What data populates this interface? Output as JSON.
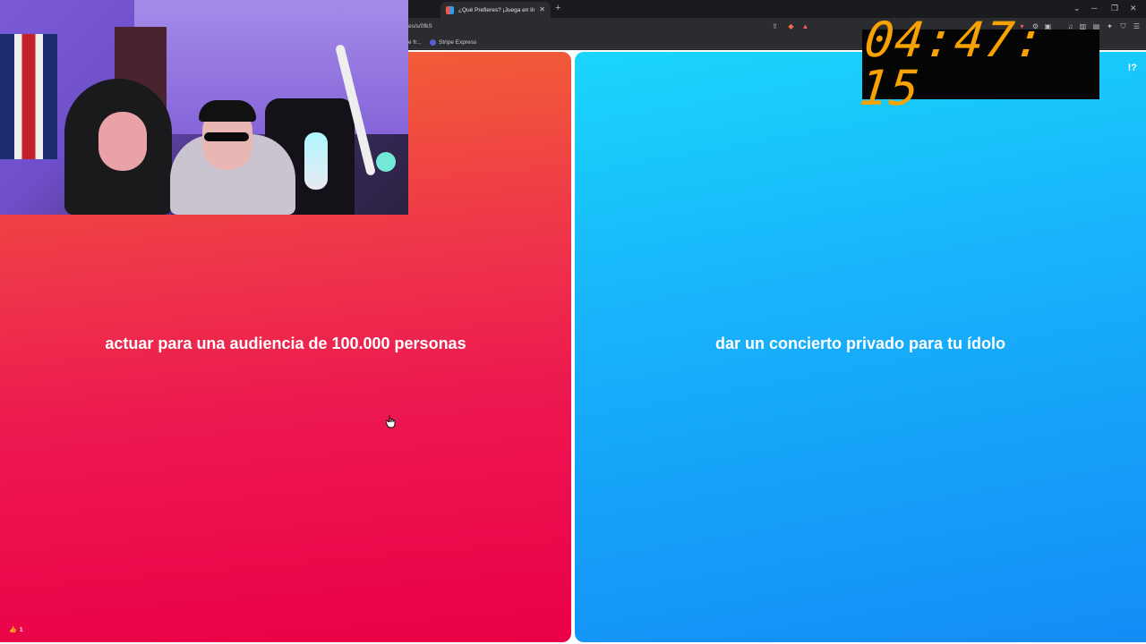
{
  "browser": {
    "tab": {
      "title": "¿Qué Prefieres? ¡Juega en línea!"
    },
    "url": "es/s/0fkS",
    "bookmarks": [
      {
        "label": "e fr..."
      },
      {
        "label": "Stripe Express"
      }
    ]
  },
  "game": {
    "left_option": "actuar para una audiencia de 100.000 personas",
    "right_option": "dar un concierto privado para tu ídolo",
    "like_count": "1"
  },
  "overlay": {
    "timer": "04:47: 15"
  },
  "colors": {
    "red_top": "#f26434",
    "red_bottom": "#ea0046",
    "blue_top": "#1ad6fb",
    "blue_bottom": "#138cf6",
    "timer": "#f7a200"
  },
  "icons": {
    "help": "!?",
    "like": "👍"
  }
}
